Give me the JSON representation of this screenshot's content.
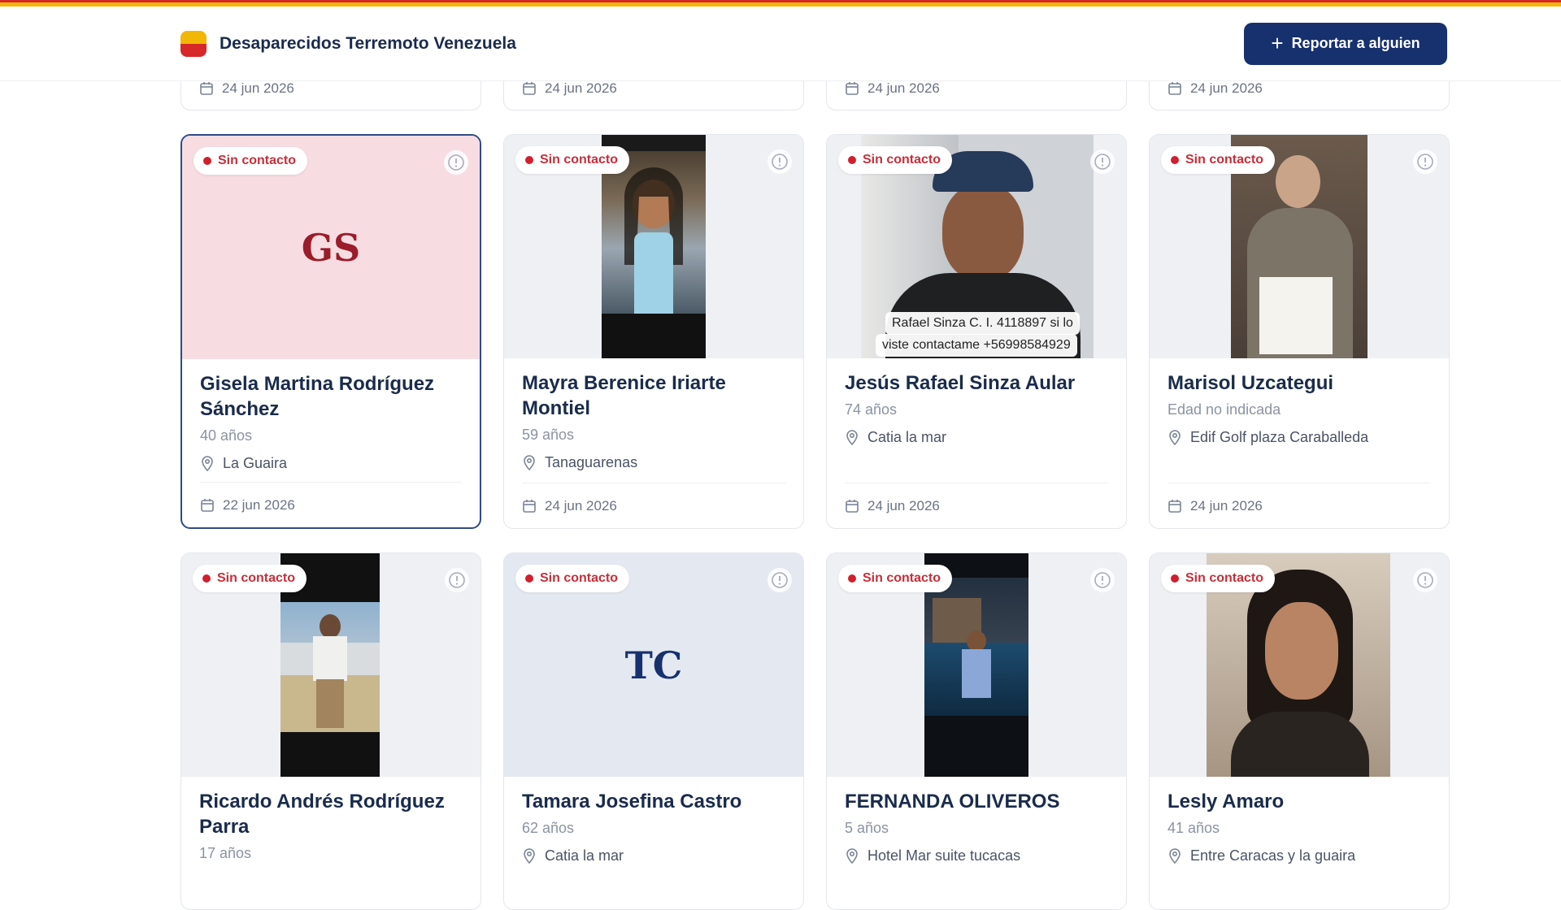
{
  "header": {
    "brand": "Desaparecidos Terremoto Venezuela",
    "report_button": "Reportar a alguien",
    "colors": {
      "accent": "#17306e",
      "stripe_red": "#d62828",
      "stripe_yellow": "#f2b705"
    }
  },
  "previous_row_dates": [
    "24 jun 2026",
    "24 jun 2026",
    "24 jun 2026",
    "24 jun 2026"
  ],
  "status_label": "Sin contacto",
  "cards": [
    {
      "name": "Gisela Martina Rodríguez Sánchez",
      "age": "40 años",
      "location": "La Guaira",
      "date": "22 jun 2026",
      "initials": "GS"
    },
    {
      "name": "Mayra Berenice Iriarte Montiel",
      "age": "59 años",
      "location": "Tanaguarenas",
      "date": "24 jun 2026"
    },
    {
      "name": "Jesús Rafael Sinza Aular",
      "age": "74 años",
      "location": "Catia la mar",
      "date": "24 jun 2026",
      "photo_caption": [
        "Rafael Sinza C. I. 4118897 si lo",
        "viste contactame +56998584929"
      ]
    },
    {
      "name": "Marisol Uzcategui",
      "age": "Edad no indicada",
      "location": "Edif Golf plaza Caraballeda",
      "date": "24 jun 2026"
    },
    {
      "name": "Ricardo Andrés Rodríguez Parra",
      "age": "17 años",
      "location": "",
      "date": ""
    },
    {
      "name": "Tamara Josefina Castro",
      "age": "62 años",
      "location": "Catia la mar",
      "date": "",
      "initials": "TC"
    },
    {
      "name": "FERNANDA OLIVEROS",
      "age": "5 años",
      "location": "Hotel Mar suite tucacas",
      "date": ""
    },
    {
      "name": "Lesly Amaro",
      "age": "41 años",
      "location": "Entre Caracas y la guaira",
      "date": ""
    }
  ]
}
